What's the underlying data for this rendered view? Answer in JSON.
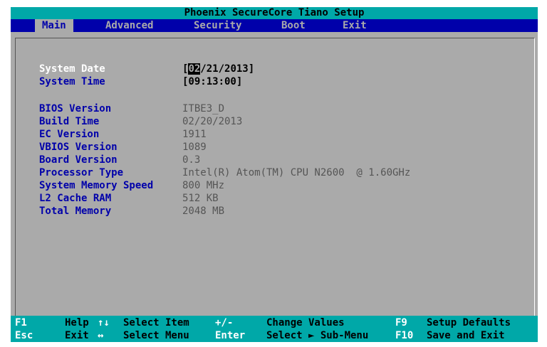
{
  "title": "Phoenix SecureCore Tiano Setup",
  "menu": {
    "tabs": [
      "Main",
      "Advanced",
      "Security",
      "Boot",
      "Exit"
    ]
  },
  "main": {
    "system_date": {
      "label": "System Date",
      "open": "[",
      "cursor": "02",
      "rest": "/21/2013]"
    },
    "system_time": {
      "label": "System Time",
      "value": "[09:13:00]"
    },
    "info": [
      {
        "label": "BIOS Version",
        "value": "ITBE3_D"
      },
      {
        "label": "Build Time",
        "value": "02/20/2013"
      },
      {
        "label": "EC Version",
        "value": "1911"
      },
      {
        "label": "VBIOS Version",
        "value": "1089"
      },
      {
        "label": "Board Version",
        "value": "0.3"
      },
      {
        "label": "Processor Type",
        "value": "Intel(R) Atom(TM) CPU N2600  @ 1.60GHz"
      },
      {
        "label": "System Memory Speed",
        "value": "800 MHz"
      },
      {
        "label": "L2 Cache RAM",
        "value": "512 KB"
      },
      {
        "label": "Total Memory",
        "value": "2048 MB"
      }
    ]
  },
  "help": {
    "row1": [
      {
        "key": "F1",
        "desc": "Help"
      },
      {
        "key": "↑↓",
        "desc": "Select Item"
      },
      {
        "key": "+/-",
        "desc": "Change Values"
      },
      {
        "key": "F9",
        "desc": "Setup Defaults"
      }
    ],
    "row2": [
      {
        "key": "Esc",
        "desc": "Exit"
      },
      {
        "key": "↔",
        "desc": "Select Menu"
      },
      {
        "key": "Enter",
        "desc": "Select ► Sub-Menu"
      },
      {
        "key": "F10",
        "desc": "Save and Exit"
      }
    ]
  },
  "colors": {
    "background": "#aaaaaa",
    "menu_bar": "#0000aa",
    "title_bar": "#00a8a8",
    "label": "#0000aa",
    "value": "#555555"
  }
}
